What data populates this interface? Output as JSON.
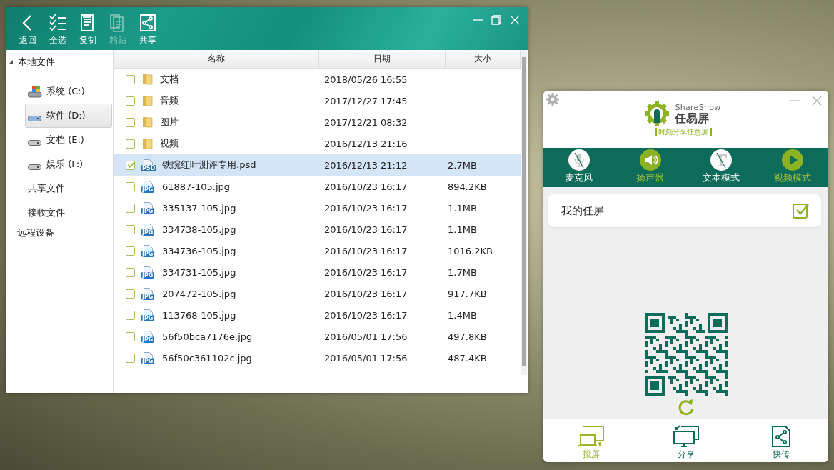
{
  "file_window": {
    "toolbar": [
      {
        "label": "返回",
        "kind": "back",
        "disabled": false
      },
      {
        "label": "全选",
        "kind": "select-all",
        "disabled": false
      },
      {
        "label": "复制",
        "kind": "copy",
        "disabled": false
      },
      {
        "label": "粘贴",
        "kind": "paste",
        "disabled": true
      },
      {
        "label": "共享",
        "kind": "share",
        "disabled": false
      }
    ],
    "sidebar": {
      "items": [
        {
          "label": "本地文件",
          "selected": false,
          "expanded": true,
          "children": [
            {
              "label": "系统 (C:)",
              "kind": "system",
              "selected": false
            },
            {
              "label": "软件 (D:)",
              "kind": "drive",
              "selected": true
            },
            {
              "label": "文档 (E:)",
              "kind": "drive",
              "selected": false
            },
            {
              "label": "娱乐 (F:)",
              "kind": "drive",
              "selected": false
            },
            {
              "label": "共享文件",
              "kind": "folder",
              "selected": false
            },
            {
              "label": "接收文件",
              "kind": "folder",
              "selected": false
            }
          ]
        },
        {
          "label": "远程设备",
          "selected": false
        }
      ]
    },
    "table": {
      "columns": [
        "名称",
        "日期",
        "大小"
      ],
      "rows": [
        {
          "name": "文档",
          "kind": "folder",
          "date": "2018/05/26 16:55",
          "checked": false,
          "selected": false
        },
        {
          "name": "音频",
          "kind": "folder",
          "date": "2017/12/27 17:45",
          "checked": false,
          "selected": false
        },
        {
          "name": "图片",
          "kind": "folder",
          "date": "2017/12/21 08:32",
          "checked": false,
          "selected": false
        },
        {
          "name": "视频",
          "kind": "folder",
          "date": "2016/12/13 21:16",
          "checked": false,
          "selected": false
        },
        {
          "name": "铁院红叶测评专用.psd",
          "kind": "file",
          "type_label": "PSD",
          "date": "2016/12/13 21:12",
          "size": "2.7MB",
          "checked": true,
          "selected": true
        },
        {
          "name": "61887-105.jpg",
          "kind": "file",
          "type_label": "JPG",
          "date": "2016/10/23 16:17",
          "size": "894.2KB",
          "checked": false,
          "selected": false
        },
        {
          "name": "335137-105.jpg",
          "kind": "file",
          "type_label": "JPG",
          "date": "2016/10/23 16:17",
          "size": "1.1MB",
          "checked": false,
          "selected": false
        },
        {
          "name": "334738-105.jpg",
          "kind": "file",
          "type_label": "JPG",
          "date": "2016/10/23 16:17",
          "size": "1.1MB",
          "checked": false,
          "selected": false
        },
        {
          "name": "334736-105.jpg",
          "kind": "file",
          "type_label": "JPG",
          "date": "2016/10/23 16:17",
          "size": "1016.2KB",
          "checked": false,
          "selected": false
        },
        {
          "name": "334731-105.jpg",
          "kind": "file",
          "type_label": "JPG",
          "date": "2016/10/23 16:17",
          "size": "1.7MB",
          "checked": false,
          "selected": false
        },
        {
          "name": "207472-105.jpg",
          "kind": "file",
          "type_label": "JPG",
          "date": "2016/10/23 16:17",
          "size": "917.7KB",
          "checked": false,
          "selected": false
        },
        {
          "name": "113768-105.jpg",
          "kind": "file",
          "type_label": "JPG",
          "date": "2016/10/23 16:17",
          "size": "1.4MB",
          "checked": false,
          "selected": false
        },
        {
          "name": "56f50bca7176e.jpg",
          "kind": "file",
          "type_label": "JPG",
          "date": "2016/05/01 17:56",
          "size": "497.8KB",
          "checked": false,
          "selected": false
        },
        {
          "name": "56f50c361102c.jpg",
          "kind": "file",
          "type_label": "JPG",
          "date": "2016/05/01 17:56",
          "size": "487.4KB",
          "checked": false,
          "selected": false
        }
      ]
    }
  },
  "share_panel": {
    "brand": "ShareShow",
    "app_name": "任易屏",
    "tagline": "时刻分享任意屏",
    "tools": [
      {
        "label": "麦克风",
        "kind": "microphone",
        "on": false
      },
      {
        "label": "扬声器",
        "kind": "speaker",
        "on": true
      },
      {
        "label": "文本模式",
        "kind": "text",
        "on": false
      },
      {
        "label": "视频模式",
        "kind": "video",
        "on": true
      }
    ],
    "device": {
      "name": "我的任屏",
      "checked": true
    },
    "nav": [
      {
        "label": "投屏",
        "kind": "cast",
        "selected": true
      },
      {
        "label": "分享",
        "kind": "share-screen",
        "selected": false
      },
      {
        "label": "快传",
        "kind": "transfer",
        "selected": false
      }
    ]
  }
}
